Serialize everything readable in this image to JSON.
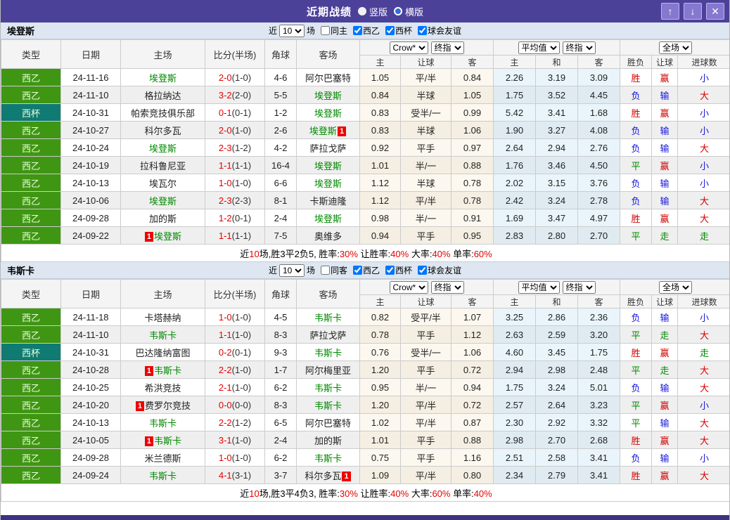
{
  "titlebar": {
    "title": "近期战绩",
    "radio_vertical_label": "竖版",
    "radio_horizontal_label": "横版",
    "up_button": "↑",
    "down_button": "↓",
    "close_button": "✕"
  },
  "filter": {
    "near_label": "近",
    "games_value": "10",
    "games_label": "场",
    "league_options": [
      "西乙",
      "西杯",
      "球会友谊"
    ],
    "league_checked": true
  },
  "columns": {
    "type": "类型",
    "date": "日期",
    "home": "主场",
    "score": "比分(半场)",
    "corner": "角球",
    "away": "客场",
    "odds_home": "主",
    "odds_handicap": "让球",
    "odds_away": "客",
    "avg_home": "主",
    "avg_draw": "和",
    "avg_away": "客",
    "result_wdl": "胜负",
    "result_handicap": "让球",
    "result_goals": "进球数"
  },
  "selects": {
    "company": "Crow*",
    "final_a": "终指",
    "average": "平均值",
    "final_b": "终指",
    "full_match": "全场"
  },
  "colors": {
    "titlebar": "#4c4199",
    "league_green": "#3f9613",
    "cup_teal": "#0f7b72",
    "team_highlight": "#008800",
    "score_red": "#e60000",
    "result_red": "#d40000",
    "result_blue": "#1616d8",
    "result_green": "#008800",
    "odds_bg": "#fdf8ef",
    "avg_bg": "#e9f5fa",
    "section_head_bg": "#dde6f1"
  },
  "sections": [
    {
      "team": "埃登斯",
      "same_side_label": "同主",
      "same_side_checked": false,
      "rows": [
        {
          "type": "西乙",
          "type_class": "league",
          "date": "24-11-16",
          "home": {
            "name": "埃登斯",
            "hl": true
          },
          "score_ft": "2-0",
          "score_ht": "(1-0)",
          "corner": "4-6",
          "away": {
            "name": "阿尔巴塞特",
            "hl": false
          },
          "odds": [
            "1.05",
            "平/半",
            "0.84"
          ],
          "avg": [
            "2.26",
            "3.19",
            "3.09"
          ],
          "results": [
            [
              "胜",
              "res-r"
            ],
            [
              "赢",
              "res-r"
            ],
            [
              "小",
              "res-b"
            ]
          ]
        },
        {
          "type": "西乙",
          "type_class": "league",
          "date": "24-11-10",
          "home": {
            "name": "格拉纳达",
            "hl": false
          },
          "score_ft": "3-2",
          "score_ht": "(2-0)",
          "corner": "5-5",
          "away": {
            "name": "埃登斯",
            "hl": true
          },
          "odds": [
            "0.84",
            "半球",
            "1.05"
          ],
          "avg": [
            "1.75",
            "3.52",
            "4.45"
          ],
          "results": [
            [
              "负",
              "res-b"
            ],
            [
              "输",
              "res-b"
            ],
            [
              "大",
              "res-r"
            ]
          ]
        },
        {
          "type": "西杯",
          "type_class": "cup",
          "date": "24-10-31",
          "home": {
            "name": "帕索竞技俱乐部",
            "hl": false
          },
          "score_ft": "0-1",
          "score_ht": "(0-1)",
          "corner": "1-2",
          "away": {
            "name": "埃登斯",
            "hl": true
          },
          "odds": [
            "0.83",
            "受半/一",
            "0.99"
          ],
          "avg": [
            "5.42",
            "3.41",
            "1.68"
          ],
          "results": [
            [
              "胜",
              "res-r"
            ],
            [
              "赢",
              "res-r"
            ],
            [
              "小",
              "res-b"
            ]
          ]
        },
        {
          "type": "西乙",
          "type_class": "league",
          "date": "24-10-27",
          "home": {
            "name": "科尔多瓦",
            "hl": false
          },
          "score_ft": "2-0",
          "score_ht": "(1-0)",
          "corner": "2-6",
          "away": {
            "name": "埃登斯",
            "hl": true,
            "badge": {
              "text": "1",
              "pos": "after"
            }
          },
          "odds": [
            "0.83",
            "半球",
            "1.06"
          ],
          "avg": [
            "1.90",
            "3.27",
            "4.08"
          ],
          "results": [
            [
              "负",
              "res-b"
            ],
            [
              "输",
              "res-b"
            ],
            [
              "小",
              "res-b"
            ]
          ]
        },
        {
          "type": "西乙",
          "type_class": "league",
          "date": "24-10-24",
          "home": {
            "name": "埃登斯",
            "hl": true
          },
          "score_ft": "2-3",
          "score_ht": "(1-2)",
          "corner": "4-2",
          "away": {
            "name": "萨拉戈萨",
            "hl": false
          },
          "odds": [
            "0.92",
            "平手",
            "0.97"
          ],
          "avg": [
            "2.64",
            "2.94",
            "2.76"
          ],
          "results": [
            [
              "负",
              "res-b"
            ],
            [
              "输",
              "res-b"
            ],
            [
              "大",
              "res-r"
            ]
          ]
        },
        {
          "type": "西乙",
          "type_class": "league",
          "date": "24-10-19",
          "home": {
            "name": "拉科鲁尼亚",
            "hl": false
          },
          "score_ft": "1-1",
          "score_ht": "(1-1)",
          "corner": "16-4",
          "away": {
            "name": "埃登斯",
            "hl": true
          },
          "odds": [
            "1.01",
            "半/一",
            "0.88"
          ],
          "avg": [
            "1.76",
            "3.46",
            "4.50"
          ],
          "results": [
            [
              "平",
              "res-g"
            ],
            [
              "赢",
              "res-r"
            ],
            [
              "小",
              "res-b"
            ]
          ]
        },
        {
          "type": "西乙",
          "type_class": "league",
          "date": "24-10-13",
          "home": {
            "name": "埃瓦尔",
            "hl": false
          },
          "score_ft": "1-0",
          "score_ht": "(1-0)",
          "corner": "6-6",
          "away": {
            "name": "埃登斯",
            "hl": true
          },
          "odds": [
            "1.12",
            "半球",
            "0.78"
          ],
          "avg": [
            "2.02",
            "3.15",
            "3.76"
          ],
          "results": [
            [
              "负",
              "res-b"
            ],
            [
              "输",
              "res-b"
            ],
            [
              "小",
              "res-b"
            ]
          ]
        },
        {
          "type": "西乙",
          "type_class": "league",
          "date": "24-10-06",
          "home": {
            "name": "埃登斯",
            "hl": true
          },
          "score_ft": "2-3",
          "score_ht": "(2-3)",
          "corner": "8-1",
          "away": {
            "name": "卡斯迪隆",
            "hl": false
          },
          "odds": [
            "1.12",
            "平/半",
            "0.78"
          ],
          "avg": [
            "2.42",
            "3.24",
            "2.78"
          ],
          "results": [
            [
              "负",
              "res-b"
            ],
            [
              "输",
              "res-b"
            ],
            [
              "大",
              "res-r"
            ]
          ]
        },
        {
          "type": "西乙",
          "type_class": "league",
          "date": "24-09-28",
          "home": {
            "name": "加的斯",
            "hl": false
          },
          "score_ft": "1-2",
          "score_ht": "(0-1)",
          "corner": "2-4",
          "away": {
            "name": "埃登斯",
            "hl": true
          },
          "odds": [
            "0.98",
            "半/一",
            "0.91"
          ],
          "avg": [
            "1.69",
            "3.47",
            "4.97"
          ],
          "results": [
            [
              "胜",
              "res-r"
            ],
            [
              "赢",
              "res-r"
            ],
            [
              "大",
              "res-r"
            ]
          ]
        },
        {
          "type": "西乙",
          "type_class": "league",
          "date": "24-09-22",
          "home": {
            "name": "埃登斯",
            "hl": true,
            "badge": {
              "text": "1",
              "pos": "before"
            }
          },
          "score_ft": "1-1",
          "score_ht": "(1-1)",
          "corner": "7-5",
          "away": {
            "name": "奥维多",
            "hl": false
          },
          "odds": [
            "0.94",
            "平手",
            "0.95"
          ],
          "avg": [
            "2.83",
            "2.80",
            "2.70"
          ],
          "results": [
            [
              "平",
              "res-g"
            ],
            [
              "走",
              "res-g"
            ],
            [
              "走",
              "res-g"
            ]
          ]
        }
      ],
      "summary": [
        [
          "近",
          "k"
        ],
        [
          "10",
          "r"
        ],
        [
          "场,胜3平2负5, 胜率:",
          "k"
        ],
        [
          "30%",
          "r"
        ],
        [
          " 让胜率:",
          "k"
        ],
        [
          "40%",
          "r"
        ],
        [
          " 大率:",
          "k"
        ],
        [
          "40%",
          "r"
        ],
        [
          " 单率:",
          "k"
        ],
        [
          "60%",
          "r"
        ]
      ]
    },
    {
      "team": "韦斯卡",
      "same_side_label": "同客",
      "same_side_checked": false,
      "rows": [
        {
          "type": "西乙",
          "type_class": "league",
          "date": "24-11-18",
          "home": {
            "name": "卡塔赫纳",
            "hl": false
          },
          "score_ft": "1-0",
          "score_ht": "(1-0)",
          "corner": "4-5",
          "away": {
            "name": "韦斯卡",
            "hl": true
          },
          "odds": [
            "0.82",
            "受平/半",
            "1.07"
          ],
          "avg": [
            "3.25",
            "2.86",
            "2.36"
          ],
          "results": [
            [
              "负",
              "res-b"
            ],
            [
              "输",
              "res-b"
            ],
            [
              "小",
              "res-b"
            ]
          ]
        },
        {
          "type": "西乙",
          "type_class": "league",
          "date": "24-11-10",
          "home": {
            "name": "韦斯卡",
            "hl": true
          },
          "score_ft": "1-1",
          "score_ht": "(1-0)",
          "corner": "8-3",
          "away": {
            "name": "萨拉戈萨",
            "hl": false
          },
          "odds": [
            "0.78",
            "平手",
            "1.12"
          ],
          "avg": [
            "2.63",
            "2.59",
            "3.20"
          ],
          "results": [
            [
              "平",
              "res-g"
            ],
            [
              "走",
              "res-g"
            ],
            [
              "大",
              "res-r"
            ]
          ]
        },
        {
          "type": "西杯",
          "type_class": "cup",
          "date": "24-10-31",
          "home": {
            "name": "巴达隆纳富图",
            "hl": false
          },
          "score_ft": "0-2",
          "score_ht": "(0-1)",
          "corner": "9-3",
          "away": {
            "name": "韦斯卡",
            "hl": true
          },
          "odds": [
            "0.76",
            "受半/一",
            "1.06"
          ],
          "avg": [
            "4.60",
            "3.45",
            "1.75"
          ],
          "results": [
            [
              "胜",
              "res-r"
            ],
            [
              "赢",
              "res-r"
            ],
            [
              "走",
              "res-g"
            ]
          ]
        },
        {
          "type": "西乙",
          "type_class": "league",
          "date": "24-10-28",
          "home": {
            "name": "韦斯卡",
            "hl": true,
            "badge": {
              "text": "1",
              "pos": "before"
            }
          },
          "score_ft": "2-2",
          "score_ht": "(1-0)",
          "corner": "1-7",
          "away": {
            "name": "阿尔梅里亚",
            "hl": false
          },
          "odds": [
            "1.20",
            "平手",
            "0.72"
          ],
          "avg": [
            "2.94",
            "2.98",
            "2.48"
          ],
          "results": [
            [
              "平",
              "res-g"
            ],
            [
              "走",
              "res-g"
            ],
            [
              "大",
              "res-r"
            ]
          ]
        },
        {
          "type": "西乙",
          "type_class": "league",
          "date": "24-10-25",
          "home": {
            "name": "希洪竞技",
            "hl": false
          },
          "score_ft": "2-1",
          "score_ht": "(1-0)",
          "corner": "6-2",
          "away": {
            "name": "韦斯卡",
            "hl": true
          },
          "odds": [
            "0.95",
            "半/一",
            "0.94"
          ],
          "avg": [
            "1.75",
            "3.24",
            "5.01"
          ],
          "results": [
            [
              "负",
              "res-b"
            ],
            [
              "输",
              "res-b"
            ],
            [
              "大",
              "res-r"
            ]
          ]
        },
        {
          "type": "西乙",
          "type_class": "league",
          "date": "24-10-20",
          "home": {
            "name": "费罗尔竞技",
            "hl": false,
            "badge": {
              "text": "1",
              "pos": "before"
            }
          },
          "score_ft": "0-0",
          "score_ht": "(0-0)",
          "corner": "8-3",
          "away": {
            "name": "韦斯卡",
            "hl": true
          },
          "odds": [
            "1.20",
            "平/半",
            "0.72"
          ],
          "avg": [
            "2.57",
            "2.64",
            "3.23"
          ],
          "results": [
            [
              "平",
              "res-g"
            ],
            [
              "赢",
              "res-r"
            ],
            [
              "小",
              "res-b"
            ]
          ]
        },
        {
          "type": "西乙",
          "type_class": "league",
          "date": "24-10-13",
          "home": {
            "name": "韦斯卡",
            "hl": true
          },
          "score_ft": "2-2",
          "score_ht": "(1-2)",
          "corner": "6-5",
          "away": {
            "name": "阿尔巴塞特",
            "hl": false
          },
          "odds": [
            "1.02",
            "平/半",
            "0.87"
          ],
          "avg": [
            "2.30",
            "2.92",
            "3.32"
          ],
          "results": [
            [
              "平",
              "res-g"
            ],
            [
              "输",
              "res-b"
            ],
            [
              "大",
              "res-r"
            ]
          ]
        },
        {
          "type": "西乙",
          "type_class": "league",
          "date": "24-10-05",
          "home": {
            "name": "韦斯卡",
            "hl": true,
            "badge": {
              "text": "1",
              "pos": "before"
            }
          },
          "score_ft": "3-1",
          "score_ht": "(1-0)",
          "corner": "2-4",
          "away": {
            "name": "加的斯",
            "hl": false
          },
          "odds": [
            "1.01",
            "平手",
            "0.88"
          ],
          "avg": [
            "2.98",
            "2.70",
            "2.68"
          ],
          "results": [
            [
              "胜",
              "res-r"
            ],
            [
              "赢",
              "res-r"
            ],
            [
              "大",
              "res-r"
            ]
          ]
        },
        {
          "type": "西乙",
          "type_class": "league",
          "date": "24-09-28",
          "home": {
            "name": "米兰德斯",
            "hl": false
          },
          "score_ft": "1-0",
          "score_ht": "(1-0)",
          "corner": "6-2",
          "away": {
            "name": "韦斯卡",
            "hl": true
          },
          "odds": [
            "0.75",
            "平手",
            "1.16"
          ],
          "avg": [
            "2.51",
            "2.58",
            "3.41"
          ],
          "results": [
            [
              "负",
              "res-b"
            ],
            [
              "输",
              "res-b"
            ],
            [
              "小",
              "res-b"
            ]
          ]
        },
        {
          "type": "西乙",
          "type_class": "league",
          "date": "24-09-24",
          "home": {
            "name": "韦斯卡",
            "hl": true
          },
          "score_ft": "4-1",
          "score_ht": "(3-1)",
          "corner": "3-7",
          "away": {
            "name": "科尔多瓦",
            "hl": false,
            "badge": {
              "text": "1",
              "pos": "after"
            }
          },
          "odds": [
            "1.09",
            "平/半",
            "0.80"
          ],
          "avg": [
            "2.34",
            "2.79",
            "3.41"
          ],
          "results": [
            [
              "胜",
              "res-r"
            ],
            [
              "赢",
              "res-r"
            ],
            [
              "大",
              "res-r"
            ]
          ]
        }
      ],
      "summary": [
        [
          "近",
          "k"
        ],
        [
          "10",
          "r"
        ],
        [
          "场,胜3平4负3, 胜率:",
          "k"
        ],
        [
          "30%",
          "r"
        ],
        [
          " 让胜率:",
          "k"
        ],
        [
          "40%",
          "r"
        ],
        [
          " 大率:",
          "k"
        ],
        [
          "60%",
          "r"
        ],
        [
          " 单率:",
          "k"
        ],
        [
          "40%",
          "r"
        ]
      ]
    }
  ]
}
